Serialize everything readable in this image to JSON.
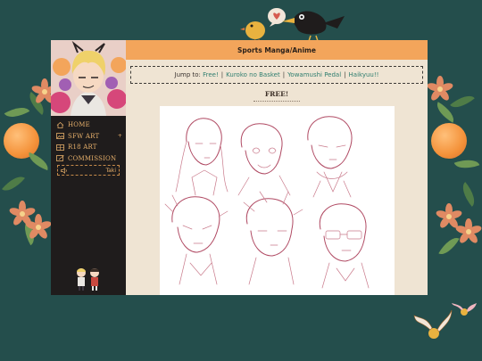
{
  "header": {
    "title": "Sports Manga/Anime"
  },
  "jump": {
    "label": "Jump to:",
    "links": [
      "Free!",
      "Kuroko no Basket",
      "Yowamushi Pedal",
      "Haikyuu!!"
    ],
    "separator": "|"
  },
  "section": {
    "title": "FREE!"
  },
  "sidebar": {
    "items": [
      {
        "label": "HOME",
        "icon": "home-icon"
      },
      {
        "label": "SFW ART",
        "icon": "image-icon",
        "caret": "+"
      },
      {
        "label": "R18 ART",
        "icon": "grid-icon"
      },
      {
        "label": "COMMISSION",
        "icon": "edit-icon"
      }
    ],
    "music": {
      "track": "Taki",
      "icon": "speaker-icon"
    }
  },
  "colors": {
    "background": "#244e4c",
    "header": "#f3a55b",
    "sidebar": "#1f1c1c",
    "accent": "#e7b06b",
    "link": "#2f7e6f",
    "content": "#efe4d3"
  }
}
